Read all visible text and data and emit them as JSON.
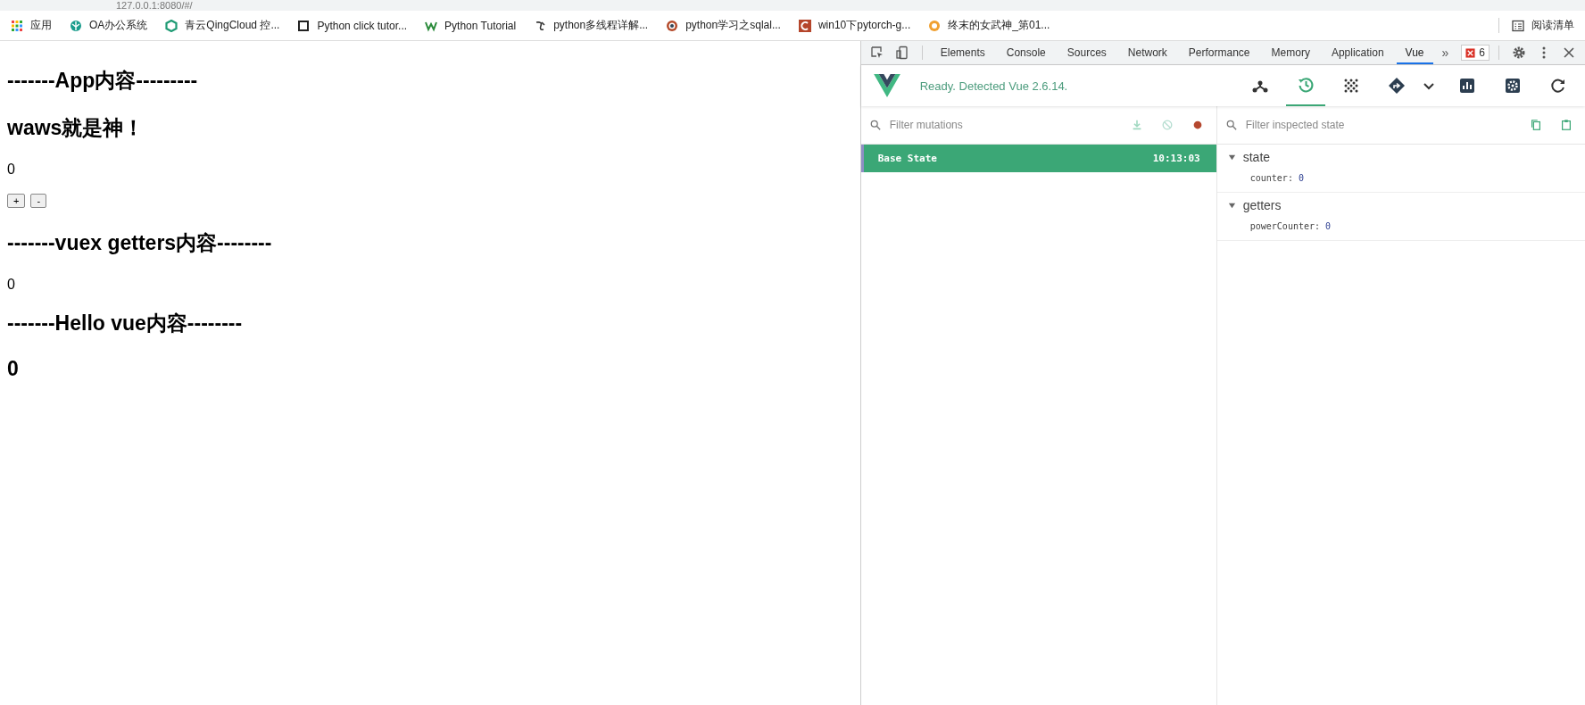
{
  "browser": {
    "address": "127.0.0.1:8080/#/",
    "bookmarks": [
      {
        "kind": "apps",
        "label": "应用"
      },
      {
        "kind": "leaf",
        "label": "OA办公系统"
      },
      {
        "kind": "hex",
        "label": "青云QingCloud 控..."
      },
      {
        "kind": "square",
        "label": "Python click tutor..."
      },
      {
        "kind": "w",
        "label": "Python Tutorial"
      },
      {
        "kind": "script",
        "label": "python多线程详解..."
      },
      {
        "kind": "target",
        "label": "python学习之sqlal..."
      },
      {
        "kind": "c",
        "label": "win10下pytorch-g..."
      },
      {
        "kind": "coin",
        "label": "终末的女武神_第01..."
      }
    ],
    "reading_list": "阅读清单"
  },
  "page": {
    "blocks": [
      {
        "kind": "heading",
        "text": "-------App内容---------"
      },
      {
        "kind": "heading",
        "text": "waws就是神！"
      },
      {
        "kind": "text",
        "text": "0"
      },
      {
        "kind": "buttons",
        "buttons": [
          "+",
          "-"
        ]
      },
      {
        "kind": "heading",
        "text": "-------vuex getters内容--------"
      },
      {
        "kind": "text",
        "text": "0"
      },
      {
        "kind": "heading",
        "text": "-------Hello vue内容--------"
      },
      {
        "kind": "heading",
        "text": "0"
      }
    ]
  },
  "devtools": {
    "tabs": [
      {
        "label": "Elements",
        "selected": false
      },
      {
        "label": "Console",
        "selected": false
      },
      {
        "label": "Sources",
        "selected": false
      },
      {
        "label": "Network",
        "selected": false
      },
      {
        "label": "Performance",
        "selected": false
      },
      {
        "label": "Memory",
        "selected": false
      },
      {
        "label": "Application",
        "selected": false
      },
      {
        "label": "Vue",
        "selected": true
      }
    ],
    "more": "»",
    "error_count": "6",
    "vue": {
      "status": "Ready. Detected Vue 2.6.14.",
      "toolbar": [
        {
          "kind": "components",
          "selected": false
        },
        {
          "kind": "history",
          "selected": true
        },
        {
          "kind": "events",
          "selected": false
        },
        {
          "kind": "routing",
          "selected": false
        },
        {
          "kind": "caret",
          "selected": false
        },
        {
          "kind": "chart",
          "selected": false
        },
        {
          "kind": "settings",
          "selected": false
        },
        {
          "kind": "refresh",
          "selected": false
        }
      ],
      "mutation_filter": {
        "placeholder": "Filter mutations"
      },
      "mutations": [
        {
          "name": "Base State",
          "time": "10:13:03",
          "selected": true
        }
      ],
      "state_filter": {
        "placeholder": "Filter inspected state"
      },
      "sections": [
        {
          "title": "state",
          "expanded": true,
          "fields": [
            {
              "key": "counter:",
              "value": "0"
            }
          ]
        },
        {
          "title": "getters",
          "expanded": true,
          "fields": [
            {
              "key": "powerCounter:",
              "value": "0"
            }
          ]
        }
      ]
    }
  }
}
